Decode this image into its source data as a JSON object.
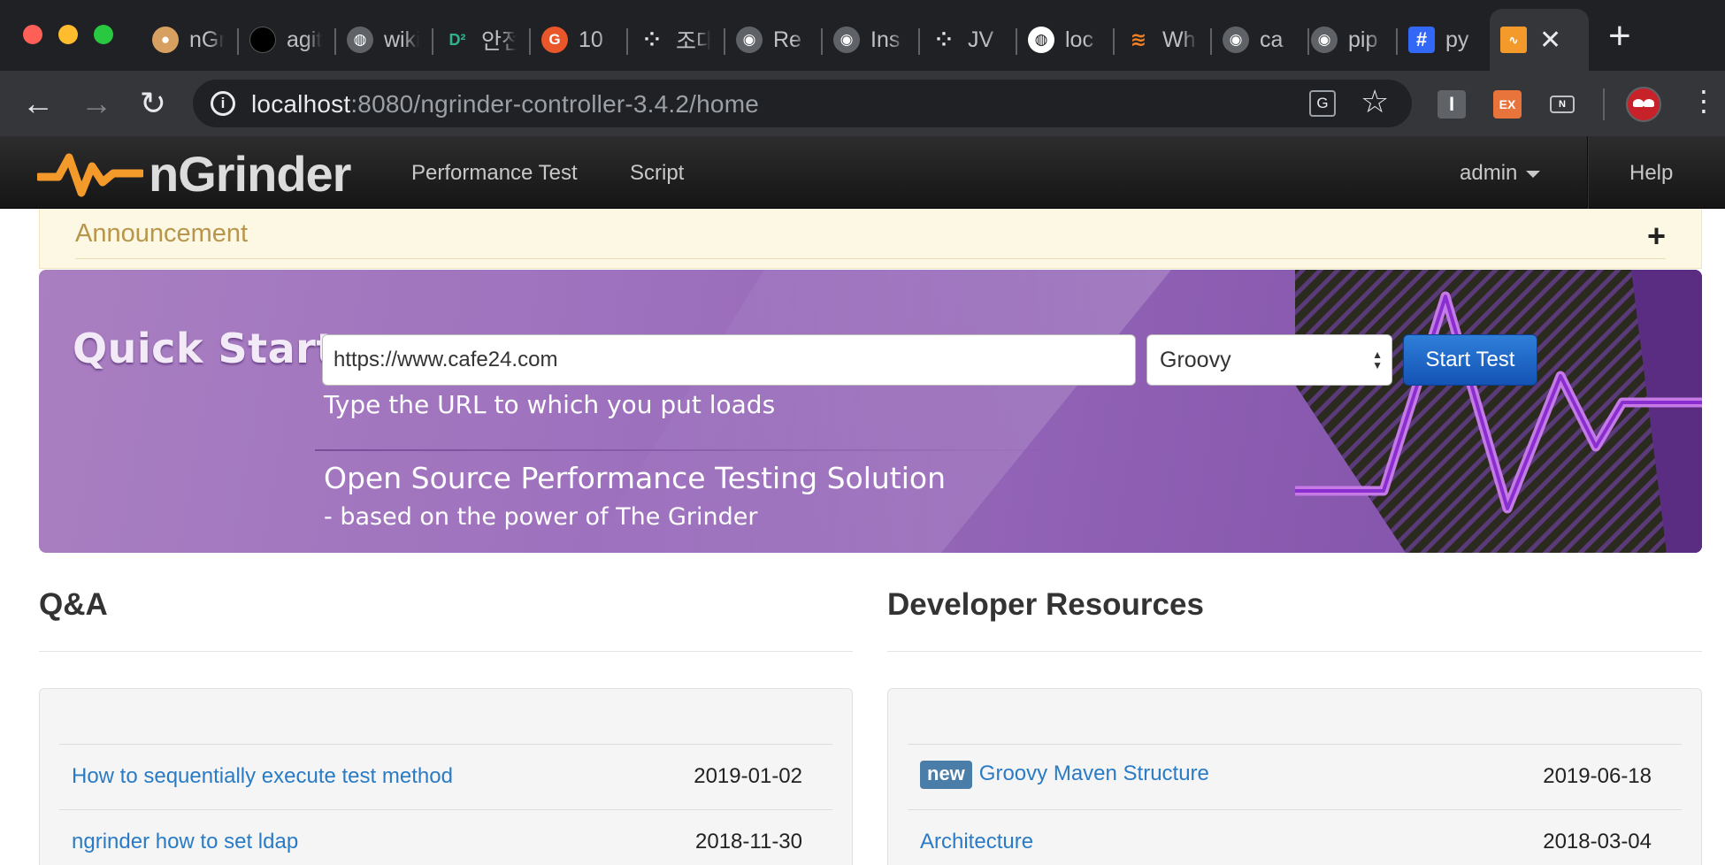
{
  "browser": {
    "tabs": [
      {
        "label": "nGrinder",
        "icon": "dog-icon",
        "color": "#d8a060"
      },
      {
        "label": "agit",
        "icon": "black-circle-icon",
        "color": "#000000"
      },
      {
        "label": "wiki",
        "icon": "globe-icon",
        "color": "#5f6368"
      },
      {
        "label": "안전",
        "icon": "d2-icon",
        "color": "#2fb38e"
      },
      {
        "label": "10",
        "icon": "gitlab-icon",
        "color": "#e8562a"
      },
      {
        "label": "조대",
        "icon": "dots-icon",
        "color": "#202124"
      },
      {
        "label": "Re",
        "icon": "github-icon",
        "color": "#5f6368"
      },
      {
        "label": "Ins",
        "icon": "github-icon",
        "color": "#5f6368"
      },
      {
        "label": "JV",
        "icon": "dots-icon",
        "color": "#202124"
      },
      {
        "label": "loc",
        "icon": "globe-white-icon",
        "color": "#ffffff"
      },
      {
        "label": "Wh",
        "icon": "stackoverflow-icon",
        "color": "#f48024"
      },
      {
        "label": "ca",
        "icon": "github-icon",
        "color": "#5f6368"
      },
      {
        "label": "pip",
        "icon": "github-icon",
        "color": "#5f6368"
      },
      {
        "label": "py",
        "icon": "hash-icon",
        "color": "#3367f6"
      }
    ],
    "active_tab_icon": "ngrinder-icon",
    "url_host": "localhost",
    "url_path": ":8080/ngrinder-controller-3.4.2/home",
    "ext_1": "I",
    "ext_2": "EX",
    "ext_3": "N"
  },
  "navbar": {
    "brand": "nGrinder",
    "items": [
      "Performance Test",
      "Script"
    ],
    "user": "admin",
    "help": "Help"
  },
  "announcement": {
    "title": "Announcement"
  },
  "quick_start": {
    "title": "Quick Start",
    "url_value": "https://www.cafe24.com",
    "language": "Groovy",
    "start_button": "Start Test",
    "hint": "Type the URL to which you put loads",
    "tagline": "Open Source Performance Testing Solution",
    "subline": "- based on the power of The Grinder"
  },
  "qa": {
    "title": "Q&A",
    "rows": [
      {
        "title": "How to sequentially execute test method",
        "date": "2019-01-02"
      },
      {
        "title": "ngrinder how to set ldap",
        "date": "2018-11-30"
      }
    ]
  },
  "dev": {
    "title": "Developer Resources",
    "badge": "new",
    "rows": [
      {
        "title": "Groovy Maven Structure",
        "date": "2019-06-18"
      },
      {
        "title": "Architecture",
        "date": "2018-03-04"
      }
    ]
  },
  "colors": {
    "accent": "#2a7bc5",
    "banner": "#9c6fbd",
    "brand_orange": "#f39a2b"
  }
}
